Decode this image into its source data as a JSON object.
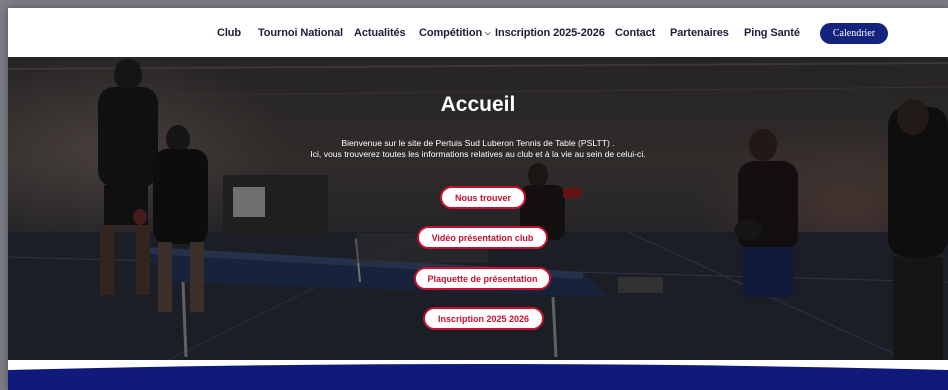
{
  "nav": {
    "items": [
      {
        "label": "Club"
      },
      {
        "label": "Tournoi National"
      },
      {
        "label": "Actualités"
      },
      {
        "label": "Compétition",
        "has_dropdown": true
      },
      {
        "label": "Inscription 2025-2026"
      },
      {
        "label": "Contact"
      },
      {
        "label": "Partenaires"
      },
      {
        "label": "Ping Santé"
      }
    ],
    "calendar_label": "Calendrier"
  },
  "hero": {
    "title": "Accueil",
    "intro_line1": "Bienvenue sur le site de Pertuis Sud Luberon Tennis de Table (PSLTT) .",
    "intro_line2": "Ici, vous trouverez toutes les informations relatives au club et à la vie au sein de celui-ci.",
    "buttons": [
      {
        "label": "Nous trouver"
      },
      {
        "label": "Vidéo présentation club"
      },
      {
        "label": "Plaquette de présentation"
      },
      {
        "label": "Inscription 2025 2026"
      }
    ]
  },
  "colors": {
    "nav_text": "#1d1d3a",
    "calendar_button": "#14237d",
    "hero_button_border": "#c8102e",
    "footer_band": "#0f1a7a"
  }
}
